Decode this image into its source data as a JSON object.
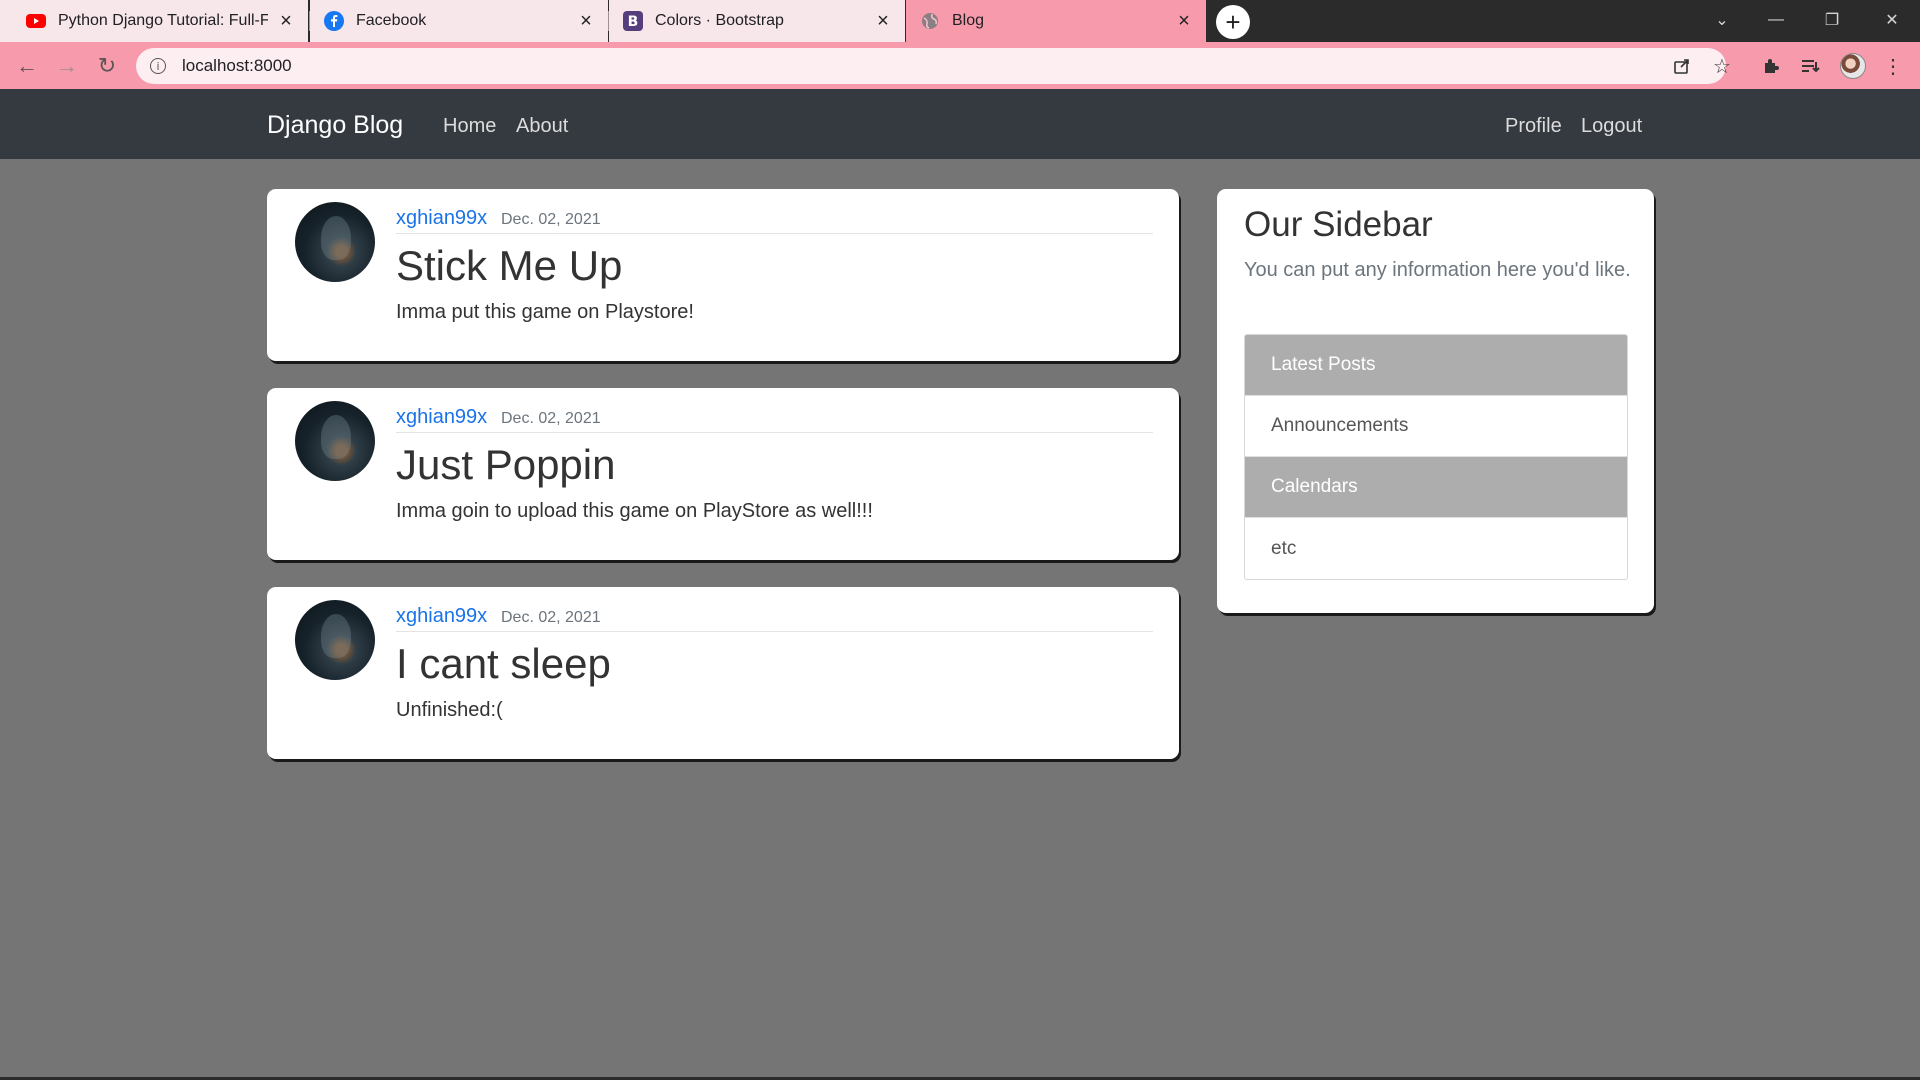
{
  "browser": {
    "tabs": [
      {
        "title": "Python Django Tutorial: Full-Feat",
        "icon": "youtube-icon",
        "active": false
      },
      {
        "title": "Facebook",
        "icon": "facebook-icon",
        "active": false
      },
      {
        "title": "Colors · Bootstrap",
        "icon": "bootstrap-icon",
        "active": false
      },
      {
        "title": "Blog",
        "icon": "globe-icon",
        "active": true
      }
    ],
    "url": "localhost:8000",
    "colors": {
      "chrome_accent": "#f79aab",
      "tab_strip": "#2b2b2b"
    }
  },
  "site": {
    "brand": "Django Blog",
    "nav_left": [
      "Home",
      "About"
    ],
    "nav_right": [
      "Profile",
      "Logout"
    ],
    "colors": {
      "navbar": "#343a40",
      "background": "#757575",
      "link": "#1a73e8"
    }
  },
  "posts": [
    {
      "author": "xghian99x",
      "date": "Dec. 02, 2021",
      "title": "Stick Me Up",
      "body": "Imma put this game on Playstore!"
    },
    {
      "author": "xghian99x",
      "date": "Dec. 02, 2021",
      "title": "Just Poppin",
      "body": "Imma goin to upload this game on PlayStore as well!!!"
    },
    {
      "author": "xghian99x",
      "date": "Dec. 02, 2021",
      "title": "I cant sleep",
      "body": "Unfinished:("
    }
  ],
  "sidebar": {
    "title": "Our Sidebar",
    "description": "You can put any information here you'd like.",
    "items": [
      {
        "label": "Latest Posts",
        "highlighted": true
      },
      {
        "label": "Announcements",
        "highlighted": false
      },
      {
        "label": "Calendars",
        "highlighted": true
      },
      {
        "label": "etc",
        "highlighted": false
      }
    ]
  }
}
